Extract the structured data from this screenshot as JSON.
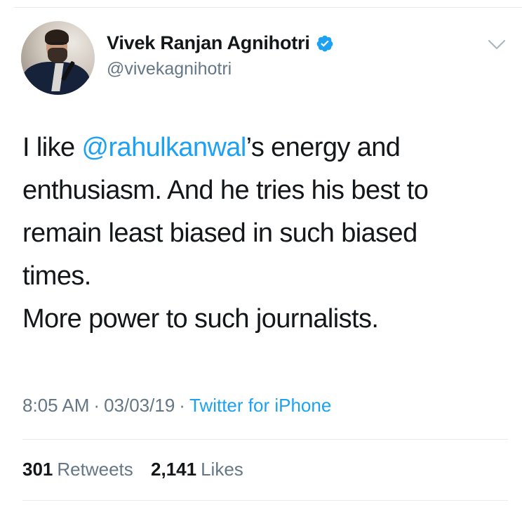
{
  "author": {
    "display_name": "Vivek Ranjan Agnihotri",
    "handle": "@vivekagnihotri",
    "verified": true,
    "avatar_icon": "profile-photo"
  },
  "tweet": {
    "lines": [
      {
        "before": "I like ",
        "mention": "@rahulkanwal",
        "after": "’s energy and"
      },
      {
        "text": "enthusiasm. And he tries his best to"
      },
      {
        "text": "remain least biased in such biased"
      },
      {
        "text": "times."
      },
      {
        "text": "More power to such journalists."
      }
    ],
    "mention_color": "#1da1f2"
  },
  "meta": {
    "time": "8:05 AM",
    "separator": "·",
    "date": "03/03/19",
    "source": "Twitter for iPhone"
  },
  "stats": {
    "retweets_count": "301",
    "retweets_label": "Retweets",
    "likes_count": "2,141",
    "likes_label": "Likes"
  },
  "icons": {
    "verified": "verified-badge-icon",
    "menu": "chevron-down-icon"
  },
  "colors": {
    "accent": "#1da1f2",
    "text": "#14171a",
    "secondary": "#657786",
    "divider": "#e6ecf0"
  }
}
